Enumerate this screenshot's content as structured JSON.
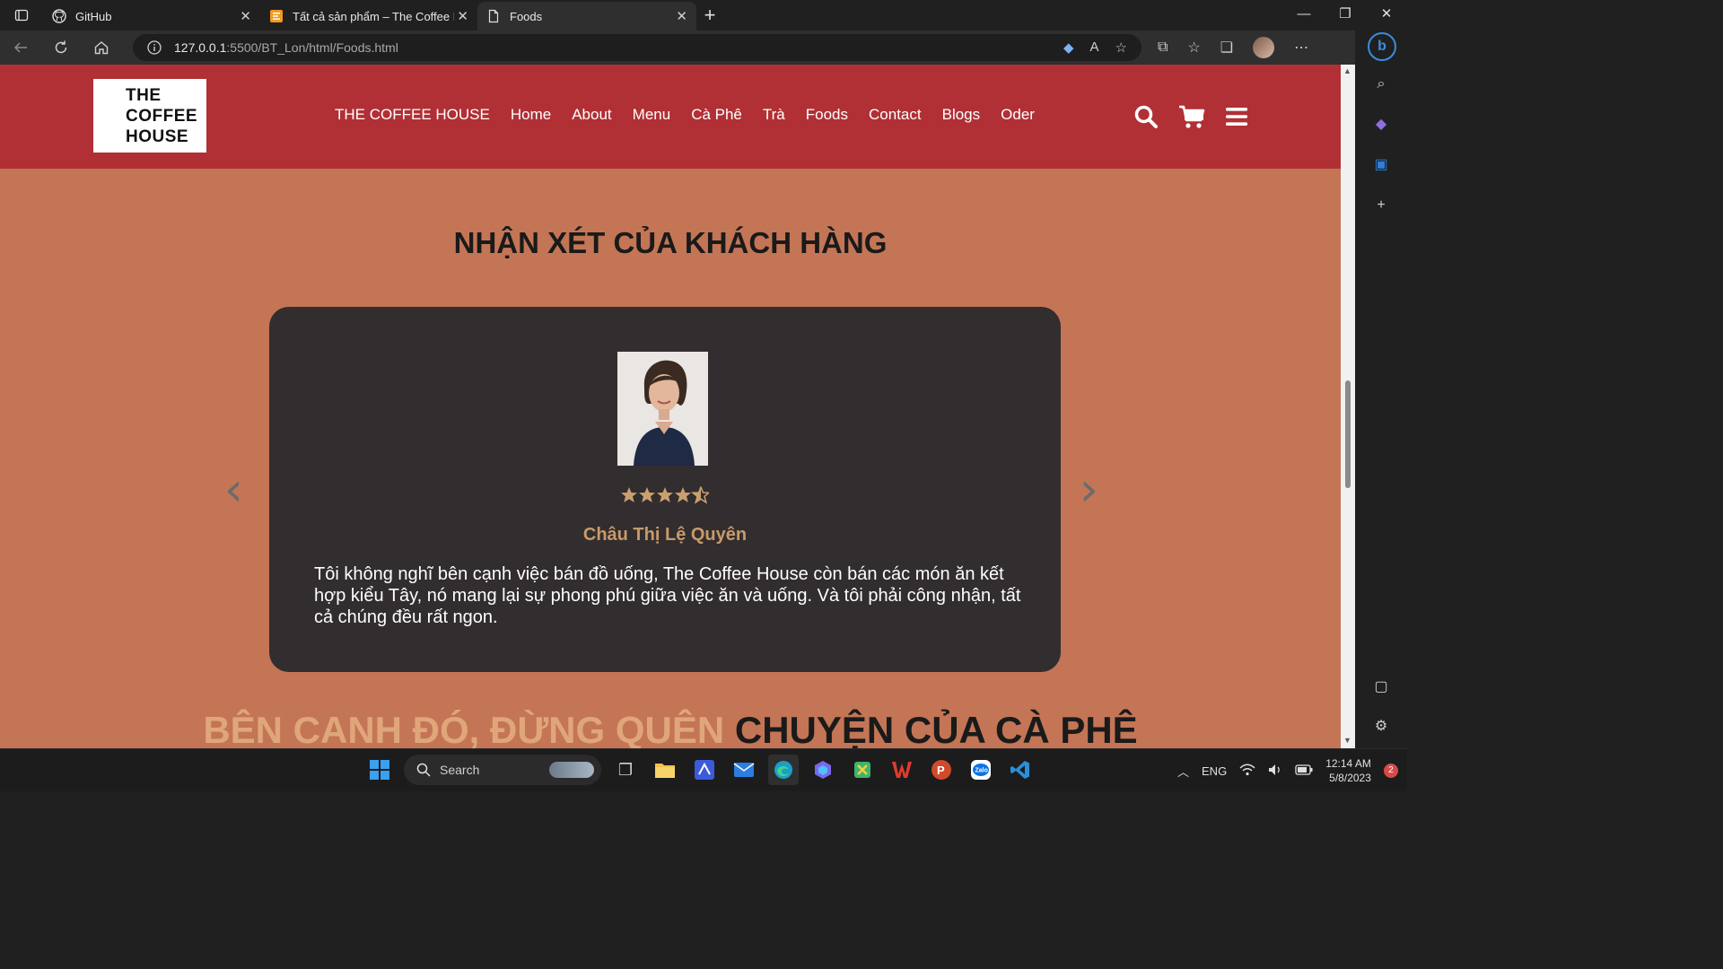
{
  "browser": {
    "tabs": [
      {
        "label": "GitHub"
      },
      {
        "label": "Tất cả sản phẩm – The Coffee House"
      },
      {
        "label": "Foods"
      }
    ],
    "url_host": "127.0.0.1",
    "url_path": ":5500/BT_Lon/html/Foods.html"
  },
  "site": {
    "logo_lines": [
      "THE",
      "COFFEE",
      "HOUSE"
    ],
    "nav": [
      "THE COFFEE HOUSE",
      "Home",
      "About",
      "Menu",
      "Cà Phê",
      "Trà",
      "Foods",
      "Contact",
      "Blogs",
      "Oder"
    ]
  },
  "reviews": {
    "title": "NHẬN XÉT CỦA KHÁCH HÀNG",
    "rating": 4.5,
    "reviewer": "Châu Thị Lệ Quyên",
    "text": "Tôi không nghĩ bên cạnh việc bán đồ uống, The Coffee House còn bán các món ăn kết hợp kiểu Tây, nó mang lại sự phong phú giữa việc ăn và uống. Và tôi phải công nhận, tất cả chúng đều rất ngon."
  },
  "bottom": {
    "part1": "BÊN CANH ĐÓ, ĐỪNG QUÊN",
    "part2": "CHUYỆN CỦA CÀ PHÊ"
  },
  "taskbar": {
    "search": "Search",
    "lang": "ENG",
    "time": "12:14 AM",
    "date": "5/8/2023",
    "notifications": "2"
  },
  "colors": {
    "header": "#b03035",
    "page_bg": "#c47555",
    "card_bg": "#322d2e",
    "accent": "#c79a6b"
  }
}
